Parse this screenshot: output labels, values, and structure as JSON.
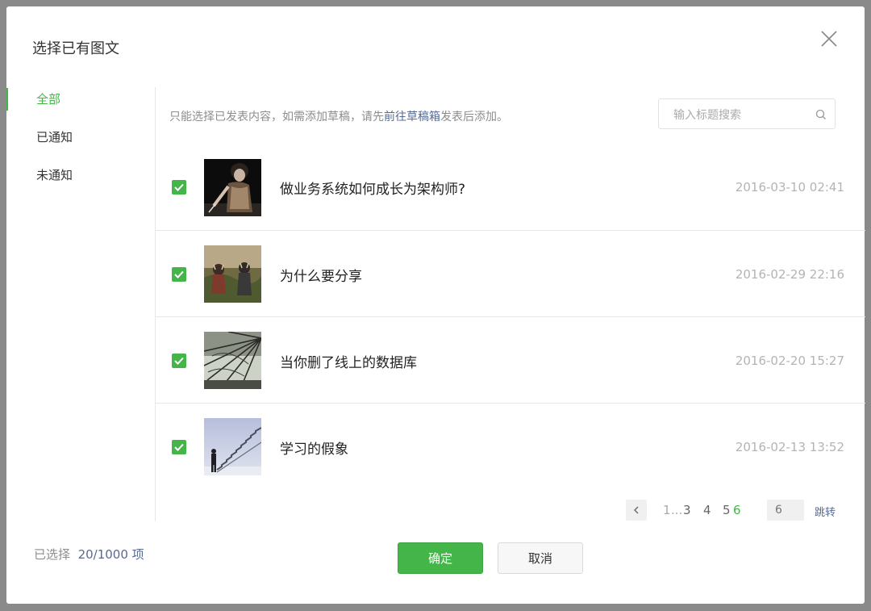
{
  "dialog": {
    "title": "选择已有图文"
  },
  "sidebar": {
    "items": [
      {
        "label": "全部"
      },
      {
        "label": "已通知"
      },
      {
        "label": "未通知"
      }
    ]
  },
  "tip": {
    "before": "只能选择已发表内容，如需添加草稿，请先",
    "link": "前往草稿箱",
    "after": "发表后添加。"
  },
  "search": {
    "placeholder": "输入标题搜索",
    "value": ""
  },
  "articles": [
    {
      "title": "做业务系统如何成长为架构师?",
      "date": "2016-03-10 02:41",
      "checked": true
    },
    {
      "title": "为什么要分享",
      "date": "2016-02-29 22:16",
      "checked": true
    },
    {
      "title": "当你删了线上的数据库",
      "date": "2016-02-20 15:27",
      "checked": true
    },
    {
      "title": "学习的假象",
      "date": "2016-02-13 13:52",
      "checked": true
    }
  ],
  "pagination": {
    "pages": [
      "1",
      "...",
      "3",
      "4",
      "5",
      "6"
    ],
    "current": "6",
    "input_placeholder": "6",
    "jump_label": "跳转"
  },
  "footer": {
    "selected_prefix": "已选择",
    "selected_value": "20/1000",
    "selected_suffix": "项",
    "confirm_label": "确定",
    "cancel_label": "取消"
  },
  "colors": {
    "accent": "#44b549",
    "link": "#576b95"
  }
}
